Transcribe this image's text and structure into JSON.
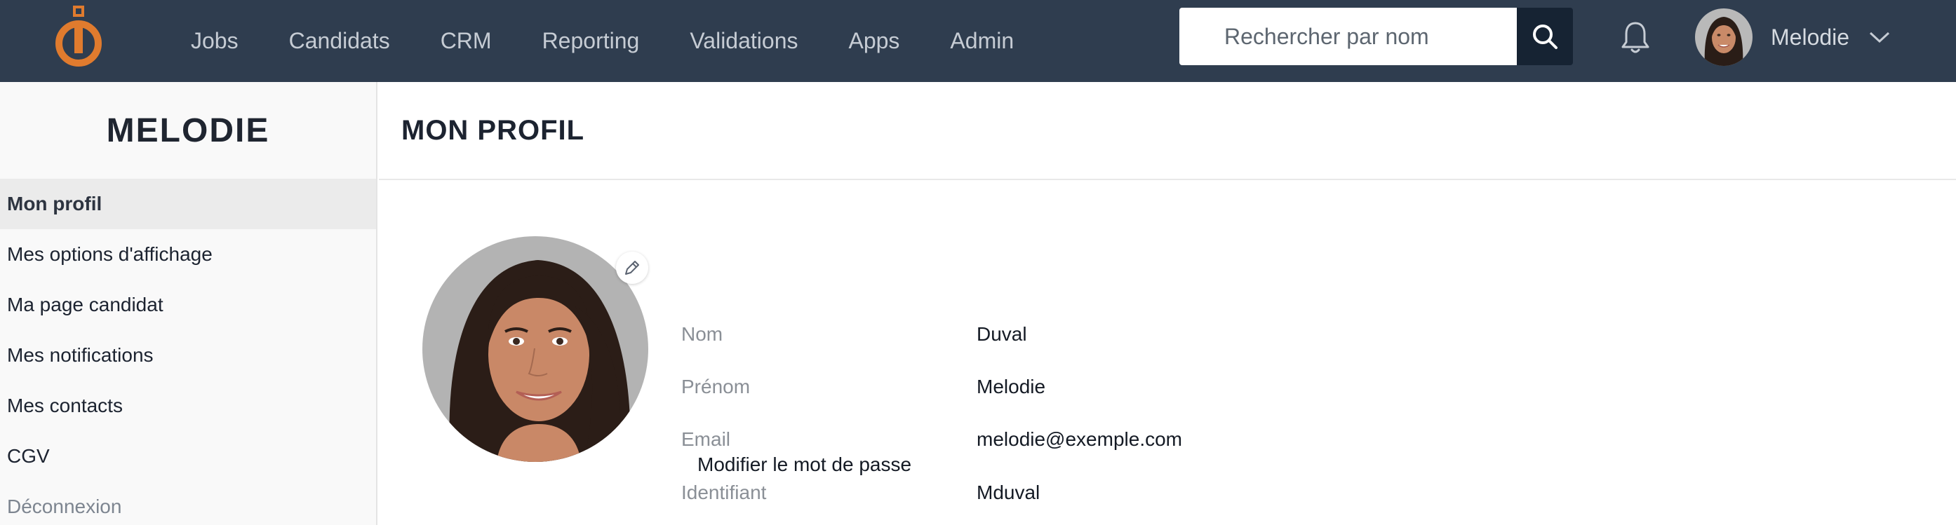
{
  "nav": {
    "items": [
      "Jobs",
      "Candidats",
      "CRM",
      "Reporting",
      "Validations",
      "Apps",
      "Admin"
    ]
  },
  "search": {
    "placeholder": "Rechercher par nom"
  },
  "user": {
    "name": "Melodie"
  },
  "sidebar": {
    "title": "MELODIE",
    "items": [
      {
        "label": "Mon profil"
      },
      {
        "label": "Mes options d'affichage"
      },
      {
        "label": "Ma page candidat"
      },
      {
        "label": "Mes notifications"
      },
      {
        "label": "Mes contacts"
      },
      {
        "label": "CGV"
      },
      {
        "label": "Déconnexion"
      }
    ]
  },
  "main": {
    "title": "MON PROFIL",
    "fields": [
      {
        "label": "Nom",
        "value": "Duval"
      },
      {
        "label": "Prénom",
        "value": "Melodie"
      },
      {
        "label": "Email",
        "value": "melodie@exemple.com"
      },
      {
        "label": "Identifiant",
        "value": "Mduval"
      }
    ],
    "change_password_label": "Modifier le mot de passe"
  },
  "colors": {
    "topbar": "#2f3d4f",
    "accent": "#e07b2e",
    "search_button": "#162333"
  },
  "icons": {
    "logo": "logo-icon",
    "search": "search-icon",
    "bell": "bell-icon",
    "chevron": "chevron-down-icon",
    "edit": "pencil-icon"
  }
}
